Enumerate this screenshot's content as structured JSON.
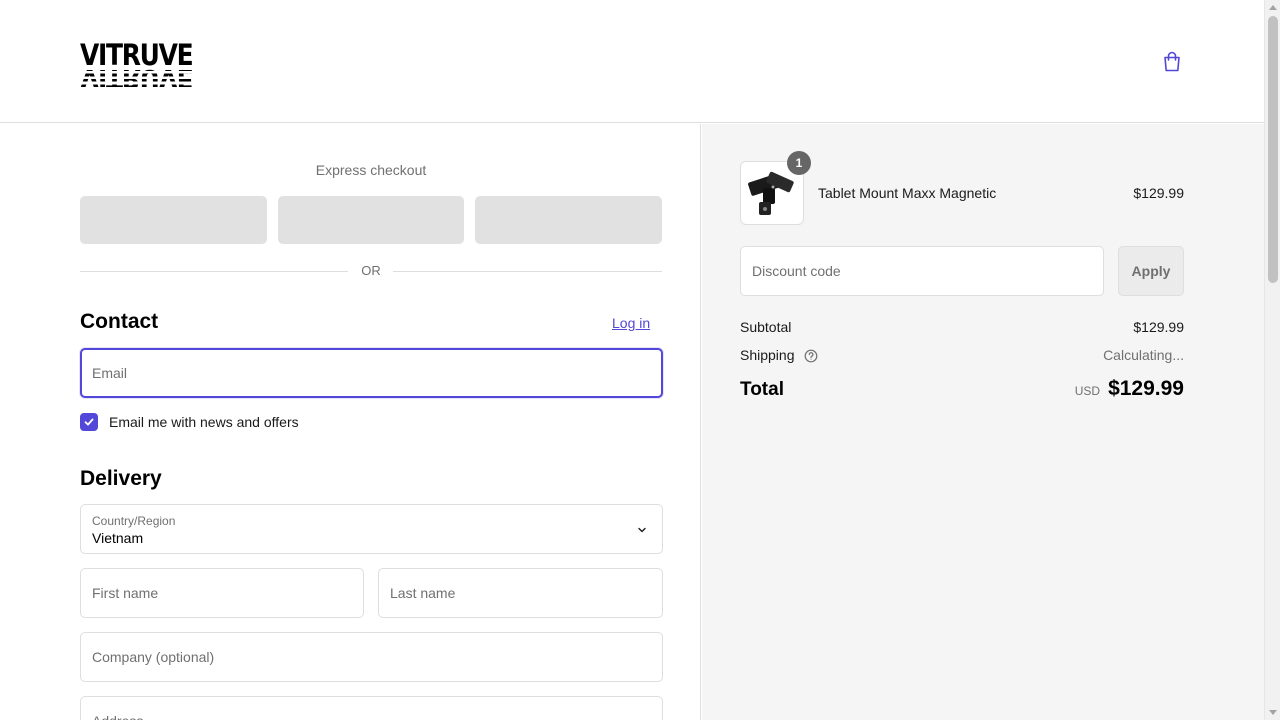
{
  "brand": {
    "logo_text": "VITRUVE",
    "accent_color": "#5247d8"
  },
  "header": {
    "cart_icon": "shopping-bag-icon"
  },
  "express_checkout": {
    "title": "Express checkout",
    "divider_text": "OR"
  },
  "contact": {
    "heading": "Contact",
    "login_label": "Log in",
    "email_placeholder": "Email",
    "newsletter_label": "Email me with news and offers",
    "newsletter_checked": true
  },
  "delivery": {
    "heading": "Delivery",
    "country_label": "Country/Region",
    "country_value": "Vietnam",
    "first_name_placeholder": "First name",
    "last_name_placeholder": "Last name",
    "company_placeholder": "Company (optional)",
    "address_placeholder": "Address"
  },
  "order_summary": {
    "item": {
      "name": "Tablet Mount Maxx Magnetic",
      "price": "$129.99",
      "quantity": "1"
    },
    "discount_placeholder": "Discount code",
    "apply_label": "Apply",
    "subtotal_label": "Subtotal",
    "subtotal_value": "$129.99",
    "shipping_label": "Shipping",
    "shipping_value": "Calculating...",
    "total_label": "Total",
    "currency": "USD",
    "total_value": "$129.99"
  }
}
